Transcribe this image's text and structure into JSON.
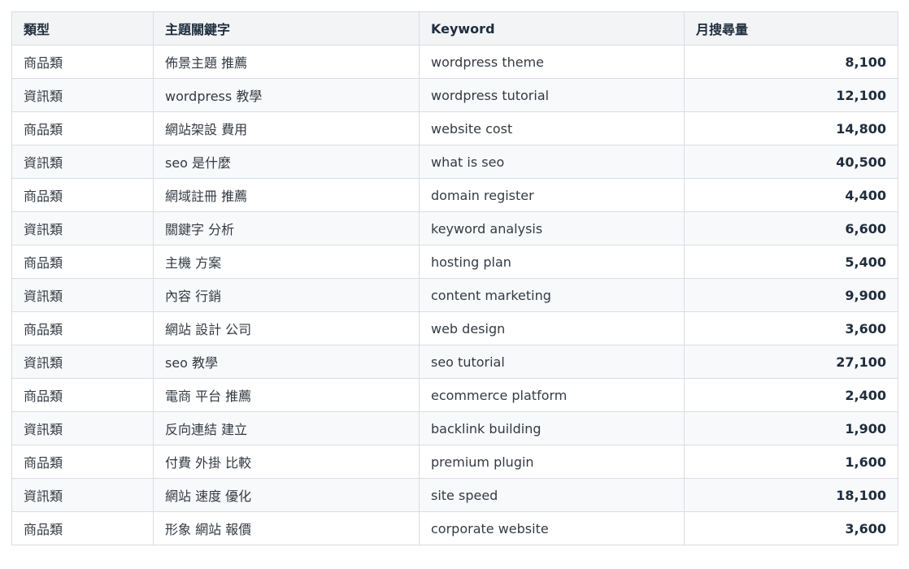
{
  "table": {
    "headers": [
      "類型",
      "主題關鍵字",
      "Keyword",
      "月搜尋量"
    ],
    "rows": [
      {
        "type": "商品類",
        "topic": "佈景主題 推薦",
        "keyword": "wordpress theme",
        "volume": "8,100"
      },
      {
        "type": "資訊類",
        "topic": "wordpress 教學",
        "keyword": "wordpress tutorial",
        "volume": "12,100"
      },
      {
        "type": "商品類",
        "topic": "網站架設 費用",
        "keyword": "website cost",
        "volume": "14,800"
      },
      {
        "type": "資訊類",
        "topic": "seo 是什麼",
        "keyword": "what is seo",
        "volume": "40,500"
      },
      {
        "type": "商品類",
        "topic": "網域註冊 推薦",
        "keyword": "domain register",
        "volume": "4,400"
      },
      {
        "type": "資訊類",
        "topic": "關鍵字 分析",
        "keyword": "keyword analysis",
        "volume": "6,600"
      },
      {
        "type": "商品類",
        "topic": "主機 方案",
        "keyword": "hosting plan",
        "volume": "5,400"
      },
      {
        "type": "資訊類",
        "topic": "內容 行銷",
        "keyword": "content marketing",
        "volume": "9,900"
      },
      {
        "type": "商品類",
        "topic": "網站 設計 公司",
        "keyword": "web design",
        "volume": "3,600"
      },
      {
        "type": "資訊類",
        "topic": "seo 教學",
        "keyword": "seo tutorial",
        "volume": "27,100"
      },
      {
        "type": "商品類",
        "topic": "電商 平台 推薦",
        "keyword": "ecommerce platform",
        "volume": "2,400"
      },
      {
        "type": "資訊類",
        "topic": "反向連結 建立",
        "keyword": "backlink building",
        "volume": "1,900"
      },
      {
        "type": "商品類",
        "topic": "付費 外掛 比較",
        "keyword": "premium plugin",
        "volume": "1,600"
      },
      {
        "type": "資訊類",
        "topic": "網站 速度 優化",
        "keyword": "site speed",
        "volume": "18,100"
      },
      {
        "type": "商品類",
        "topic": "形象 網站 報價",
        "keyword": "corporate website",
        "volume": "3,600"
      }
    ]
  }
}
